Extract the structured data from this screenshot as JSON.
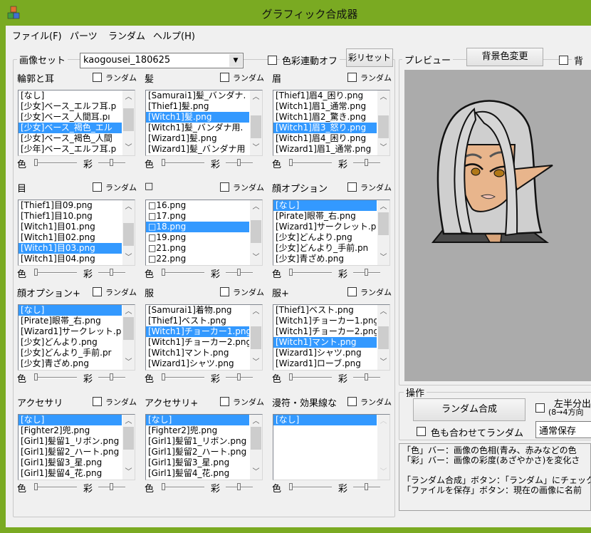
{
  "window": {
    "title": "グラフィック合成器",
    "accent": "#7aaa22"
  },
  "menu": [
    "ファイル(F)",
    "パーツ",
    "ランダム",
    "ヘルプ(H)"
  ],
  "image_set": {
    "label": "画像セット",
    "value": "kaogousei_180625",
    "link_off_label": "色彩連動オフ",
    "reset_button": "彩リセット"
  },
  "random_label": "ランダム",
  "hue_label": "色",
  "sat_label": "彩",
  "panels": [
    {
      "label": "輪郭と耳",
      "items": [
        "[なし]",
        "[少女]ベース_エルフ耳.p",
        "[少女]ベース_人間耳.pı",
        "[少女]ベース_褐色_エル",
        "[少女]ベース_褐色_人間",
        "[少年]ベース_エルフ耳.p"
      ],
      "selected": 3,
      "scroll": 0.35
    },
    {
      "label": "髪",
      "items": [
        "[Samurai1]髪_バンダナ.",
        "[Thief1]髪.png",
        "[Witch1]髪.png",
        "[Witch1]髪_バンダナ用.",
        "[Wizard1]髪.png",
        "[Wizard1]髪_バンダナ用"
      ],
      "selected": 2,
      "scroll": 0.7
    },
    {
      "label": "眉",
      "items": [
        "[Thief1]眉4_困り.png",
        "[Witch1]眉1_通常.png",
        "[Witch1]眉2_驚き.png",
        "[Witch1]眉3_怒り.png",
        "[Witch1]眉4_困り.png",
        "[Wizard1]眉1_通常.png"
      ],
      "selected": 3,
      "scroll": 0.7
    },
    {
      "label": "目",
      "items": [
        "[Thief1]目09.png",
        "[Thief1]目10.png",
        "[Witch1]目01.png",
        "[Witch1]目02.png",
        "[Witch1]目03.png",
        "[Witch1]目04.png"
      ],
      "selected": 4,
      "scroll": 0.6
    },
    {
      "label": "□",
      "items": [
        "□16.png",
        "□17.png",
        "□18.png",
        "□19.png",
        "□21.png",
        "□22.png"
      ],
      "selected": 2,
      "scroll": 0.45
    },
    {
      "label": "顔オプション",
      "items": [
        "[なし]",
        "[Pirate]眼帯_右.png",
        "[Wizard1]サークレット.pr",
        "[少女]どんより.png",
        "[少女]どんより_手前.pn",
        "[少女]青ざめ.png"
      ],
      "selected": 0,
      "scroll": 0.05
    },
    {
      "label": "顔オプション+",
      "items": [
        "[なし]",
        "[Pirate]眼帯_右.png",
        "[Wizard1]サークレット.p",
        "[少女]どんより.png",
        "[少女]どんより_手前.pr",
        "[少女]青ざめ.png"
      ],
      "selected": 0,
      "scroll": 0.05
    },
    {
      "label": "服",
      "items": [
        "[Samurai1]着物.png",
        "[Thief1]ベスト.png",
        "[Witch1]チョーカー1.png",
        "[Witch1]チョーカー2.png",
        "[Witch1]マント.png",
        "[Wizard1]シャツ.png"
      ],
      "selected": 2,
      "scroll": 0.5
    },
    {
      "label": "服+",
      "items": [
        "[Thief1]ベスト.png",
        "[Witch1]チョーカー1.png",
        "[Witch1]チョーカー2.png",
        "[Witch1]マント.png",
        "[Wizard1]シャツ.png",
        "[Wizard1]ローブ.png"
      ],
      "selected": 3,
      "scroll": 0.5
    },
    {
      "label": "アクセサリ",
      "items": [
        "[なし]",
        "[Fighter2]兜.png",
        "[Girl1]髪留1_リボン.png",
        "[Girl1]髪留2_ハート.png",
        "[Girl1]髪留3_星.png",
        "[Girl1]髪留4_花.png"
      ],
      "selected": 0,
      "scroll": 0.05
    },
    {
      "label": "アクセサリ+",
      "items": [
        "[なし]",
        "[Fighter2]兜.png",
        "[Girl1]髪留1_リボン.png",
        "[Girl1]髪留2_ハート.png",
        "[Girl1]髪留3_星.png",
        "[Girl1]髪留4_花.png"
      ],
      "selected": 0,
      "scroll": 0.05
    },
    {
      "label": "漫符・効果線な",
      "items": [
        "[なし]"
      ],
      "selected": 0,
      "scroll": null
    }
  ],
  "preview": {
    "label": "プレビュー",
    "bg_button": "背景色変更",
    "bg_check_label": "背景",
    "bg_color": "#ababab"
  },
  "operation": {
    "label": "操作",
    "random_button": "ランダム合成",
    "color_random_label": "色も合わせてランダム",
    "half_label_1": "左半分出",
    "half_label_2": "(8→4方向",
    "save_mode": "通常保存"
  },
  "info_text": "「色」バー：画像の色相(青み、赤みなどの色\n「彩」バー：画像の彩度(あざやかさ)を変化さ\n\n「ランダム合成」ボタン：「ランダム」にチェックが\n「ファイルを保存」ボタン：現在の画像に名前"
}
